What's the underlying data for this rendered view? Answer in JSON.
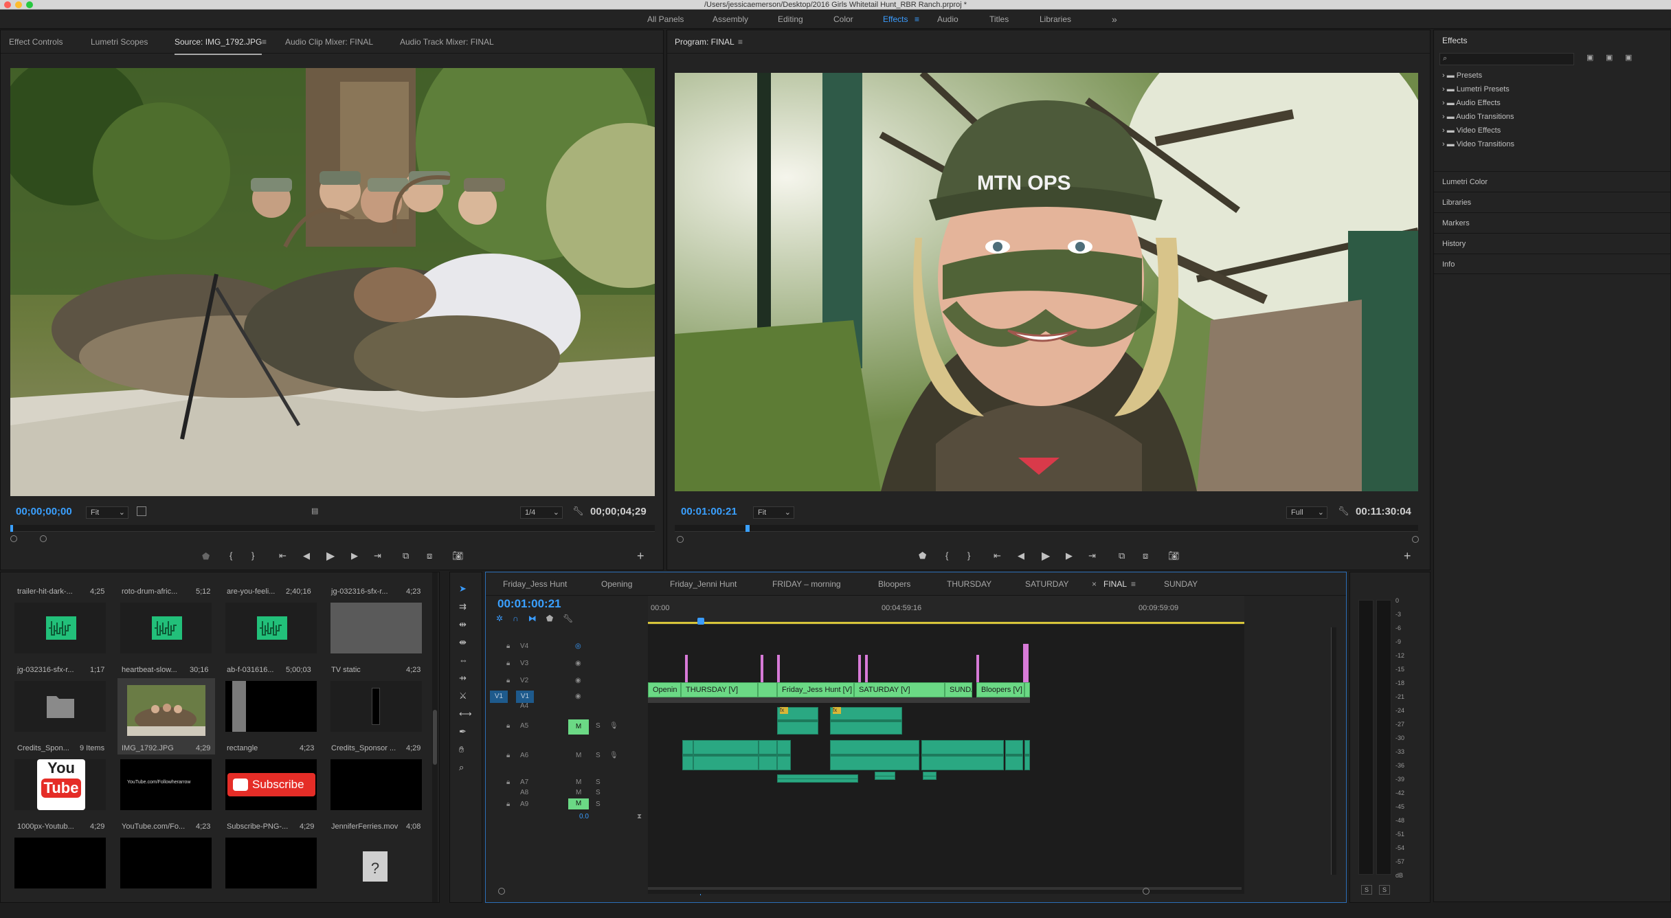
{
  "window": {
    "title": "/Users/jessicaemerson/Desktop/2016 Girls Whitetail Hunt_RBR Ranch.prproj *"
  },
  "workspaces": [
    "All Panels",
    "Assembly",
    "Editing",
    "Color",
    "Effects",
    "Audio",
    "Titles",
    "Libraries"
  ],
  "workspace_active": "Effects",
  "source_panel": {
    "tabs": [
      "Effect Controls",
      "Lumetri Scopes",
      "Source: IMG_1792.JPG",
      "Audio Clip Mixer: FINAL",
      "Audio Track Mixer: FINAL"
    ],
    "active_tab": "Source: IMG_1792.JPG",
    "timecode_in": "00;00;00;00",
    "fit": "Fit",
    "resolution": "1/4",
    "duration": "00;00;04;29"
  },
  "program_panel": {
    "tab": "Program: FINAL",
    "timecode": "00:01:00:21",
    "fit": "Fit",
    "resolution": "Full",
    "duration": "00:11:30:04",
    "cap_text": "MTN OPS"
  },
  "effects_panel": {
    "title": "Effects",
    "folders": [
      "Presets",
      "Lumetri Presets",
      "Audio Effects",
      "Audio Transitions",
      "Video Effects",
      "Video Transitions"
    ],
    "sections": [
      "Lumetri Color",
      "Libraries",
      "Markers",
      "History",
      "Info"
    ]
  },
  "project_bin": {
    "top_row": [
      {
        "name": "trailer-hit-dark-...",
        "dur": "4;25"
      },
      {
        "name": "roto-drum-afric...",
        "dur": "5;12"
      },
      {
        "name": "are-you-feeli...",
        "dur": "2;40;16"
      },
      {
        "name": "jg-032316-sfx-r...",
        "dur": "4;23"
      }
    ],
    "items": [
      {
        "name": "jg-032316-sfx-r...",
        "dur": "1;17",
        "kind": "audio"
      },
      {
        "name": "heartbeat-slow...",
        "dur": "30;16",
        "kind": "audio"
      },
      {
        "name": "ab-f-031616...",
        "dur": "5;00;03",
        "kind": "audio"
      },
      {
        "name": "TV static",
        "dur": "4;23",
        "kind": "gray"
      },
      {
        "name": "Credits_Spon...",
        "dur": "9 Items",
        "kind": "folder"
      },
      {
        "name": "IMG_1792.JPG",
        "dur": "4;29",
        "kind": "photo"
      },
      {
        "name": "rectangle",
        "dur": "4;23",
        "kind": "rect"
      },
      {
        "name": "Credits_Sponsor ...",
        "dur": "4;29",
        "kind": "credits"
      },
      {
        "name": "1000px-Youtub...",
        "dur": "4;29",
        "kind": "youtube"
      },
      {
        "name": "YouTube.com/Fo...",
        "dur": "4;23",
        "kind": "ytlink"
      },
      {
        "name": "Subscribe-PNG-...",
        "dur": "4;29",
        "kind": "subscribe"
      },
      {
        "name": "JenniferFerries.mov",
        "dur": "4;08",
        "kind": "black"
      }
    ],
    "youtube_you": "You",
    "youtube_tube": "Tube",
    "ytlink_text": "YouTube.com/Followherarrow",
    "subscribe_text": "Subscribe",
    "unknown_glyph": "?"
  },
  "timeline": {
    "tabs": [
      "Friday_Jess Hunt",
      "Opening",
      "Friday_Jenni Hunt",
      "FRIDAY – morning",
      "Bloopers",
      "THURSDAY",
      "SATURDAY",
      "FINAL",
      "SUNDAY"
    ],
    "active_tab": "FINAL",
    "timecode": "00:01:00:21",
    "ruler": [
      "00:00",
      "00:04:59:16",
      "00:09:59:09"
    ],
    "video_tracks": [
      "V4",
      "V3",
      "V2",
      "V1"
    ],
    "audio_tracks": [
      "A4",
      "A5",
      "A6",
      "A7",
      "A8",
      "A9"
    ],
    "v1_clips": [
      "Openin",
      "THURSDAY [V]",
      "Friday_Jess Hunt [V]",
      "SATURDAY [V]",
      "SUNDA",
      "Bloopers [V]"
    ],
    "master_value": "0.0",
    "source_patch": "V1",
    "mute_label": "M",
    "solo_label": "S",
    "fx_label": "fx"
  },
  "audio_meter": {
    "scale": [
      "0",
      "-3",
      "-6",
      "-9",
      "-12",
      "-15",
      "-18",
      "-21",
      "-24",
      "-27",
      "-30",
      "-33",
      "-36",
      "-39",
      "-42",
      "-45",
      "-48",
      "-51",
      "-54",
      "-57",
      "dB"
    ],
    "solo": [
      "S",
      "S"
    ]
  }
}
